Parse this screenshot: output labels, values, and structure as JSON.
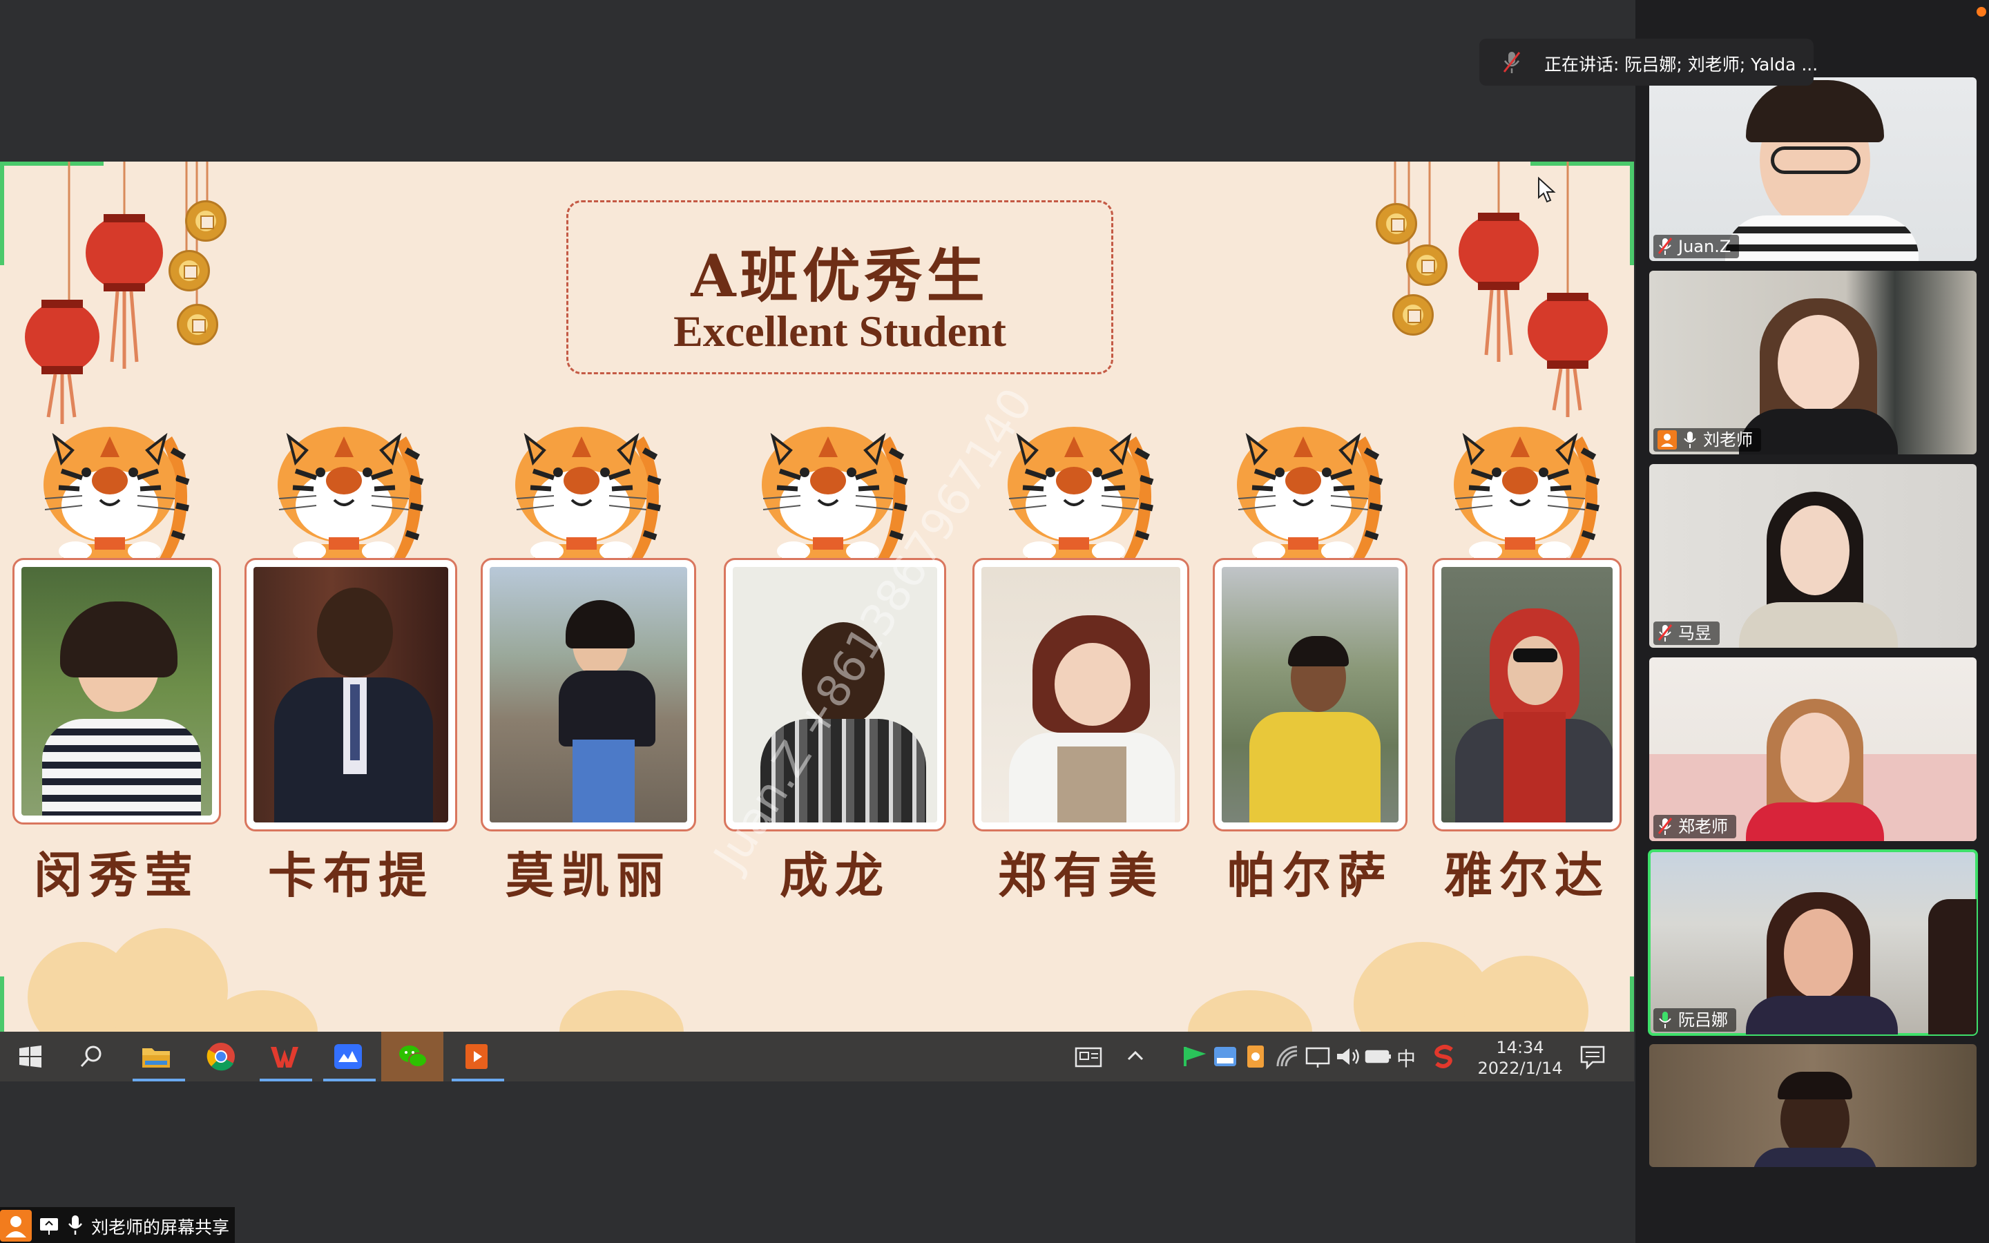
{
  "speaking": {
    "text": "正在讲话: 阮吕娜; 刘老师; Yalda ..."
  },
  "slide": {
    "title_cn": "A班优秀生",
    "title_en": "Excellent Student",
    "watermark": "Juan.Z  +8613867967140",
    "students": [
      {
        "name": "闵秀莹"
      },
      {
        "name": "卡布提"
      },
      {
        "name": "莫凯丽"
      },
      {
        "name": "成龙"
      },
      {
        "name": "郑有美"
      },
      {
        "name": "帕尔萨"
      },
      {
        "name": "雅尔达"
      }
    ]
  },
  "taskbar": {
    "time": "14:34",
    "date": "2022/1/14",
    "ime": "中",
    "apps": [
      "windows-start",
      "search",
      "file-explorer",
      "chrome",
      "wps-office",
      "feishu",
      "wechat",
      "media-player"
    ]
  },
  "participants": [
    {
      "name": "Juan.Z",
      "muted": true
    },
    {
      "name": "刘老师",
      "muted": false,
      "host": true
    },
    {
      "name": "马昱",
      "muted": true
    },
    {
      "name": "郑老师",
      "muted": true
    },
    {
      "name": "阮吕娜",
      "muted": false,
      "active_speaker": true
    },
    {
      "name": "",
      "muted": false
    }
  ],
  "share_bar": {
    "text": "刘老师的屏幕共享"
  },
  "colors": {
    "active_speaker": "#3ee06a",
    "slide_bg": "#f8e8d8",
    "title_brown": "#6e2e16",
    "card_border": "#d9765e"
  }
}
